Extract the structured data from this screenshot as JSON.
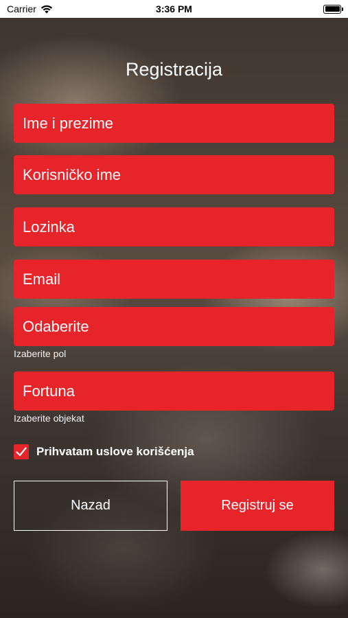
{
  "status_bar": {
    "carrier": "Carrier",
    "time": "3:36 PM",
    "wifi_icon": "wifi-icon",
    "battery_icon": "battery-icon"
  },
  "page": {
    "title": "Registracija"
  },
  "form": {
    "full_name_placeholder": "Ime i prezime",
    "username_placeholder": "Korisničko ime",
    "password_placeholder": "Lozinka",
    "email_placeholder": "Email",
    "gender_value": "Odaberite",
    "gender_hint": "Izaberite pol",
    "venue_value": "Fortuna",
    "venue_hint": "Izaberite objekat",
    "terms_label": "Prihvatam uslove korišćenja",
    "terms_checked": true
  },
  "actions": {
    "back_label": "Nazad",
    "register_label": "Registruj se"
  },
  "colors": {
    "accent": "#e8242b",
    "text": "#ffffff"
  }
}
